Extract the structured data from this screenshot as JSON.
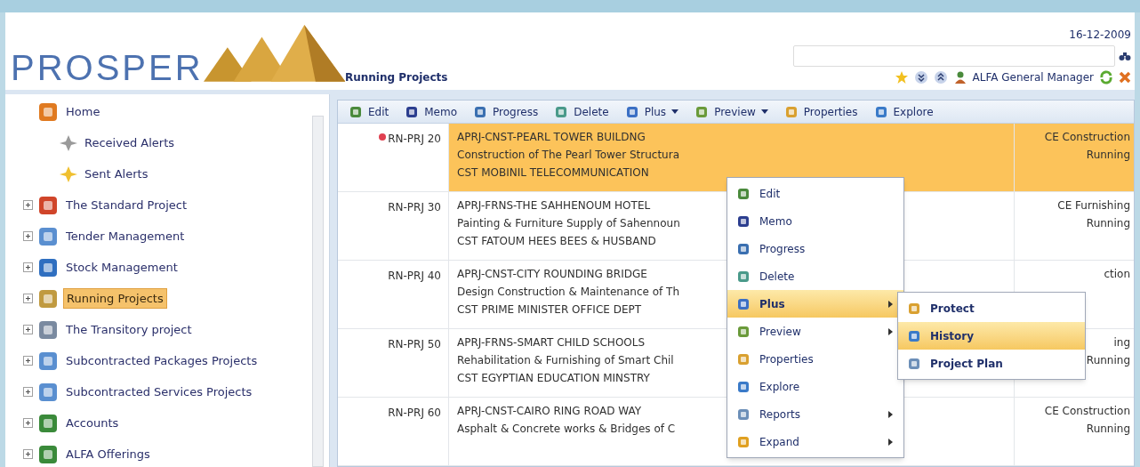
{
  "logo": {
    "text": "PROSPER"
  },
  "header": {
    "date": "16-12-2009",
    "user": "ALFA General Manager",
    "page_title": "Running Projects"
  },
  "tree": [
    {
      "label": "Home",
      "selected": false,
      "children": [
        {
          "label": "Received Alerts",
          "selected": false
        },
        {
          "label": "Sent Alerts",
          "selected": false
        }
      ]
    },
    {
      "label": "The Standard Project",
      "expanded": false,
      "selected": false
    },
    {
      "label": "Tender Management",
      "expanded": false,
      "selected": false
    },
    {
      "label": "Stock Management",
      "expanded": false,
      "selected": false
    },
    {
      "label": "Running Projects",
      "expanded": false,
      "selected": true
    },
    {
      "label": "The Transitory project",
      "expanded": false,
      "selected": false
    },
    {
      "label": "Subcontracted Packages Projects",
      "expanded": false,
      "selected": false
    },
    {
      "label": "Subcontracted Services Projects",
      "expanded": false,
      "selected": false
    },
    {
      "label": "Accounts",
      "expanded": false,
      "selected": false
    },
    {
      "label": "ALFA Offerings",
      "expanded": false,
      "selected": false
    }
  ],
  "toolbar": [
    {
      "label": "Edit",
      "dropdown": false
    },
    {
      "label": "Memo",
      "dropdown": false
    },
    {
      "label": "Progress",
      "dropdown": false
    },
    {
      "label": "Delete",
      "dropdown": false
    },
    {
      "label": "Plus",
      "dropdown": true
    },
    {
      "label": "Preview",
      "dropdown": true
    },
    {
      "label": "Properties",
      "dropdown": false
    },
    {
      "label": "Explore",
      "dropdown": false
    }
  ],
  "rows": [
    {
      "id": "RN-PRJ 20",
      "flagged": true,
      "selected": true,
      "lines": [
        "APRJ-CNST-PEARL TOWER BUILDNG",
        "Construction of The Pearl Tower Structura",
        "CST MOBINIL TELECOMMUNICATION"
      ],
      "status": [
        "CE Construction",
        "Running"
      ]
    },
    {
      "id": "RN-PRJ 30",
      "flagged": false,
      "selected": false,
      "lines": [
        "APRJ-FRNS-THE SAHHENOUM HOTEL",
        "Painting & Furniture Supply of Sahennoun",
        "CST FATOUM HEES BEES & HUSBAND"
      ],
      "status": [
        "CE Furnishing",
        "Running"
      ]
    },
    {
      "id": "RN-PRJ 40",
      "flagged": false,
      "selected": false,
      "lines": [
        "APRJ-CNST-CITY ROUNDING BRIDGE",
        "Design Construction & Maintenance of Th",
        "CST PRIME MINISTER OFFICE DEPT"
      ],
      "status": [
        "ction"
      ]
    },
    {
      "id": "RN-PRJ 50",
      "flagged": false,
      "selected": false,
      "lines": [
        "APRJ-FRNS-SMART CHILD SCHOOLS",
        "Rehabilitation & Furnishing of Smart Chil",
        "CST EGYPTIAN EDUCATION MINSTRY"
      ],
      "status": [
        "ing",
        "Running"
      ]
    },
    {
      "id": "RN-PRJ 60",
      "flagged": false,
      "selected": false,
      "lines": [
        "APRJ-CNST-CAIRO RING ROAD WAY",
        "Asphalt & Concrete works & Bridges of C"
      ],
      "status": [
        "CE Construction",
        "Running"
      ]
    }
  ],
  "context_menu": [
    {
      "label": "Edit",
      "submenu": false,
      "selected": false
    },
    {
      "label": "Memo",
      "submenu": false,
      "selected": false
    },
    {
      "label": "Progress",
      "submenu": false,
      "selected": false
    },
    {
      "label": "Delete",
      "submenu": false,
      "selected": false
    },
    {
      "label": "Plus",
      "submenu": true,
      "selected": true
    },
    {
      "label": "Preview",
      "submenu": true,
      "selected": false
    },
    {
      "label": "Properties",
      "submenu": false,
      "selected": false
    },
    {
      "label": "Explore",
      "submenu": false,
      "selected": false
    },
    {
      "label": "Reports",
      "submenu": true,
      "selected": false
    },
    {
      "label": "Expand",
      "submenu": true,
      "selected": false
    }
  ],
  "submenu": [
    {
      "label": "Protect",
      "selected": false
    },
    {
      "label": "History",
      "selected": true
    },
    {
      "label": "Project Plan",
      "selected": false
    }
  ]
}
